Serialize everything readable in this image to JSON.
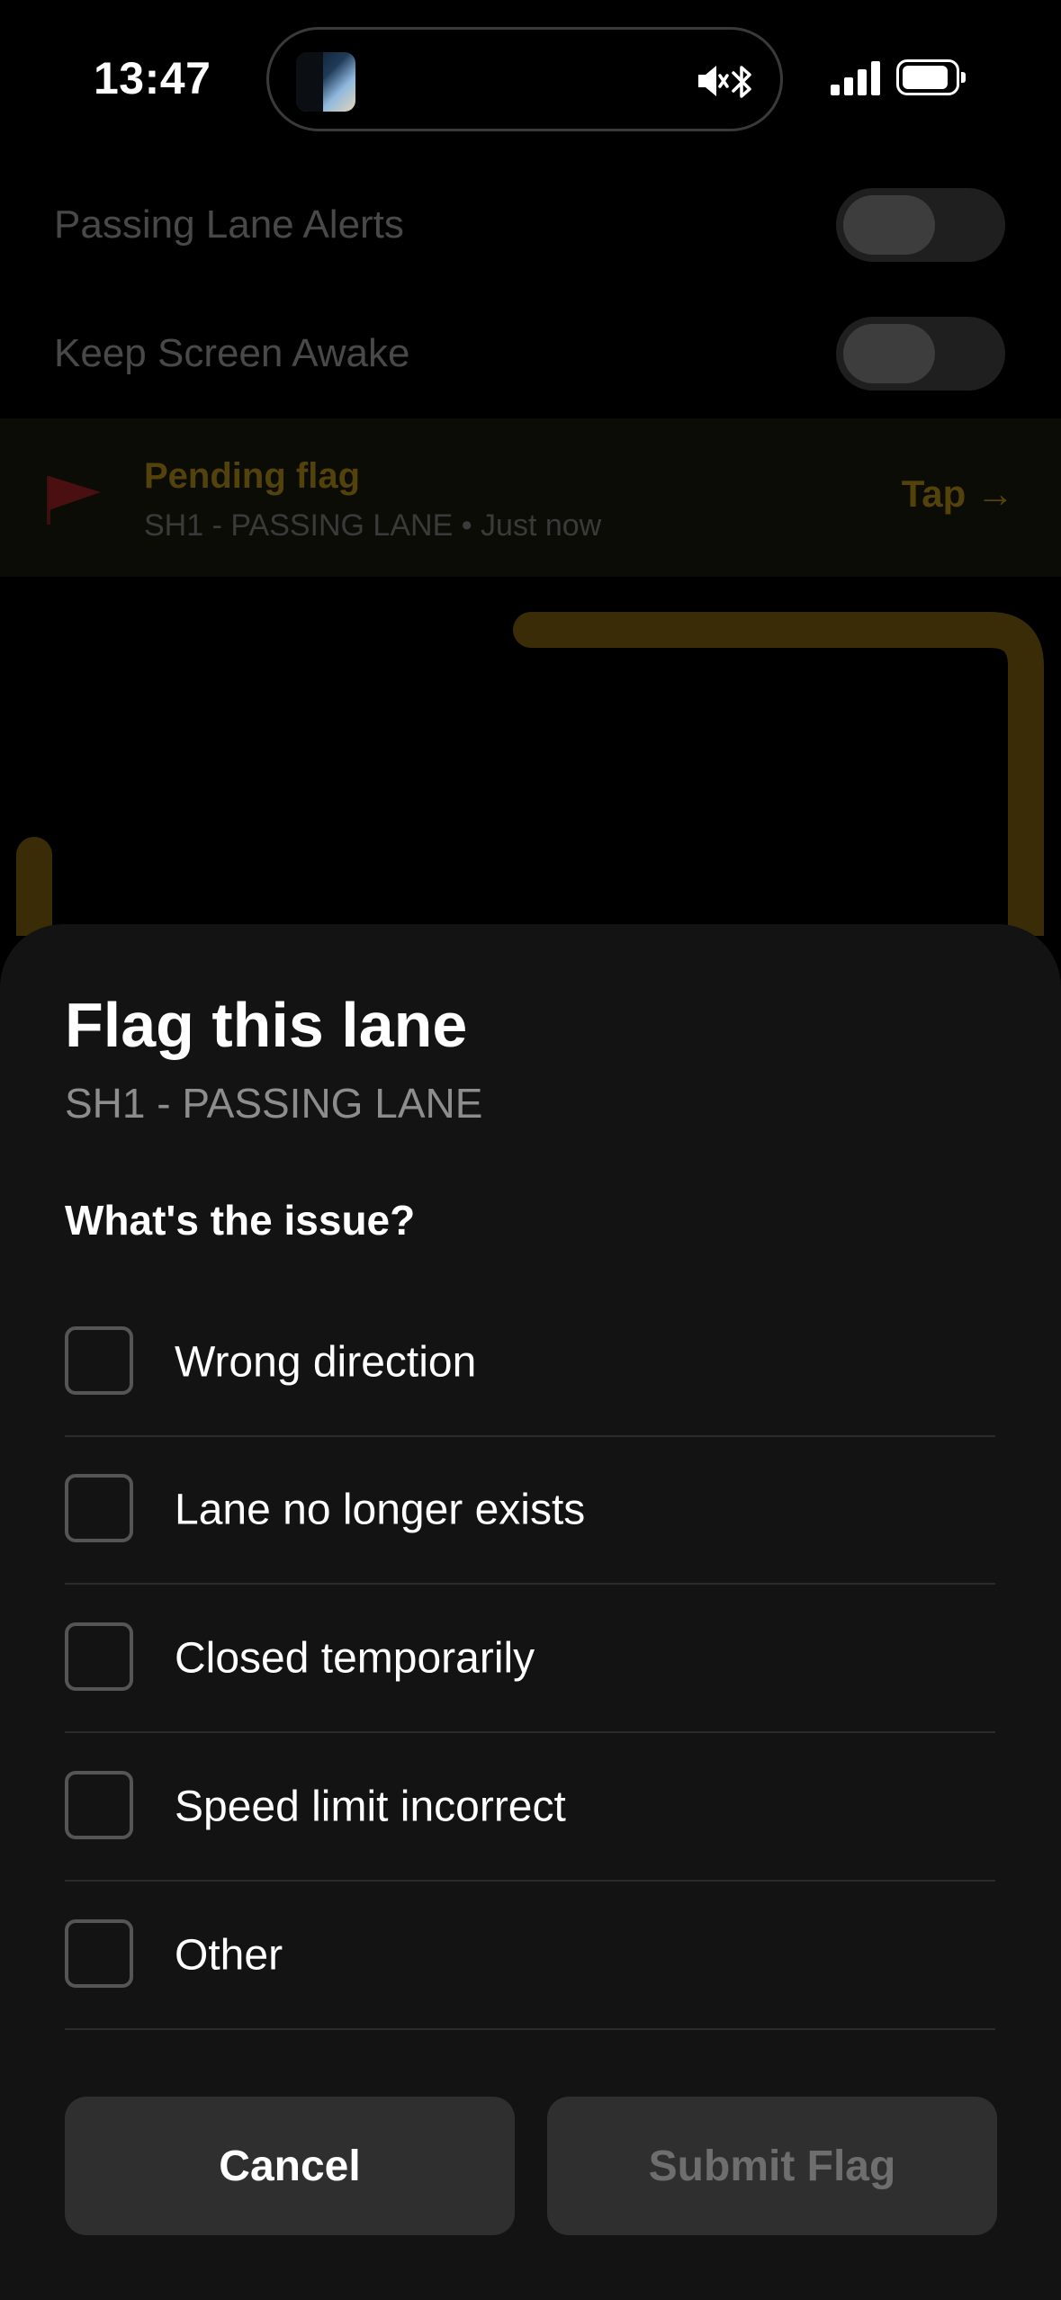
{
  "status_bar": {
    "time": "13:47"
  },
  "settings": [
    {
      "label": "Passing Lane Alerts",
      "enabled": false
    },
    {
      "label": "Keep Screen Awake",
      "enabled": false
    }
  ],
  "pending": {
    "title": "Pending flag",
    "subtitle": "SH1 - PASSING LANE • Just now",
    "action": "Tap →"
  },
  "sheet": {
    "title": "Flag this lane",
    "subtitle": "SH1 - PASSING LANE",
    "question": "What's the issue?",
    "options": [
      {
        "label": "Wrong direction",
        "checked": false
      },
      {
        "label": "Lane no longer exists",
        "checked": false
      },
      {
        "label": "Closed temporarily",
        "checked": false
      },
      {
        "label": "Speed limit incorrect",
        "checked": false
      },
      {
        "label": "Other",
        "checked": false
      }
    ],
    "cancel_label": "Cancel",
    "submit_label": "Submit Flag"
  },
  "colors": {
    "accent_dim": "#54420b",
    "route": "#3a2c07",
    "sheet_bg": "#131313"
  }
}
